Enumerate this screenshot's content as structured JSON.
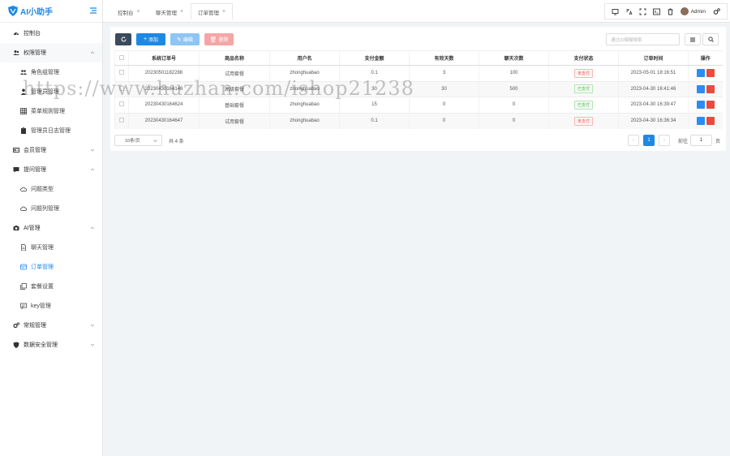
{
  "app": {
    "title": "AI小助手"
  },
  "sidebar": {
    "items": [
      {
        "label": "控制台",
        "icon": "dashboard-icon"
      },
      {
        "label": "权限管理",
        "icon": "users-icon",
        "expanded": true
      },
      {
        "label": "角色组管理",
        "icon": "user-group-icon"
      },
      {
        "label": "管理员管理",
        "icon": "user-icon"
      },
      {
        "label": "菜单规则管理",
        "icon": "grid-icon"
      },
      {
        "label": "管理员日志管理",
        "icon": "clipboard-icon"
      },
      {
        "label": "会员管理",
        "icon": "id-card-icon"
      },
      {
        "label": "提问管理",
        "icon": "chat-icon",
        "expanded": true
      },
      {
        "label": "问题类型",
        "icon": "cloud-icon"
      },
      {
        "label": "问题列管理",
        "icon": "cloud-icon"
      },
      {
        "label": "AI管理",
        "icon": "camera-icon",
        "expanded": true
      },
      {
        "label": "聊天管理",
        "icon": "file-icon"
      },
      {
        "label": "订单管理",
        "icon": "order-icon",
        "active": true
      },
      {
        "label": "套餐设置",
        "icon": "copy-icon"
      },
      {
        "label": "key管理",
        "icon": "message-icon"
      },
      {
        "label": "常规管理",
        "icon": "cogs-icon"
      },
      {
        "label": "数据安全管理",
        "icon": "shield-icon"
      }
    ]
  },
  "tabs": [
    {
      "label": "控制台"
    },
    {
      "label": "聊天管理"
    },
    {
      "label": "订单管理",
      "active": true
    }
  ],
  "topbar": {
    "user": "Admin"
  },
  "toolbar": {
    "add": "添加",
    "edit": "编辑",
    "delete": "删除",
    "search_placeholder": "通过ID模糊搜索"
  },
  "table": {
    "headers": [
      "系统订单号",
      "商品名称",
      "用户名",
      "支付金额",
      "有效天数",
      "聊天次数",
      "支付状态",
      "订单时间",
      "操作"
    ],
    "rows": [
      {
        "order_no": "20230501182288",
        "product": "试用套餐",
        "user": "zhonghuabao",
        "amount": "0.1",
        "days": "3",
        "chats": "100",
        "status": "未支付",
        "paid": false,
        "time": "2023-05-01 18:16:51"
      },
      {
        "order_no": "20230430164146",
        "product": "高级套餐",
        "user": "zhonghuabao",
        "amount": "30",
        "days": "30",
        "chats": "500",
        "status": "已支付",
        "paid": true,
        "time": "2023-04-30 16:41:46"
      },
      {
        "order_no": "20230430164624",
        "product": "基础套餐",
        "user": "zhonghuabao",
        "amount": "15",
        "days": "0",
        "chats": "0",
        "status": "已支付",
        "paid": true,
        "time": "2023-04-30 16:39:47"
      },
      {
        "order_no": "20230430164647",
        "product": "试用套餐",
        "user": "zhonghuabao",
        "amount": "0.1",
        "days": "0",
        "chats": "0",
        "status": "未支付",
        "paid": false,
        "time": "2023-04-30 16:36:34"
      }
    ]
  },
  "pagination": {
    "page_size": "10条/页",
    "total": "共 4 条",
    "current": "1",
    "goto_prefix": "前往",
    "goto_value": "1",
    "goto_suffix": "页"
  },
  "watermark": "https://www.huzhan.com/ishop21238",
  "colors": {
    "primary": "#1e88e5",
    "dark_btn": "#3b4a5c",
    "edit_disabled": "#8ec5f5",
    "delete_disabled": "#f6a5a5",
    "unpaid": "#e55555",
    "paid": "#4caf50"
  }
}
